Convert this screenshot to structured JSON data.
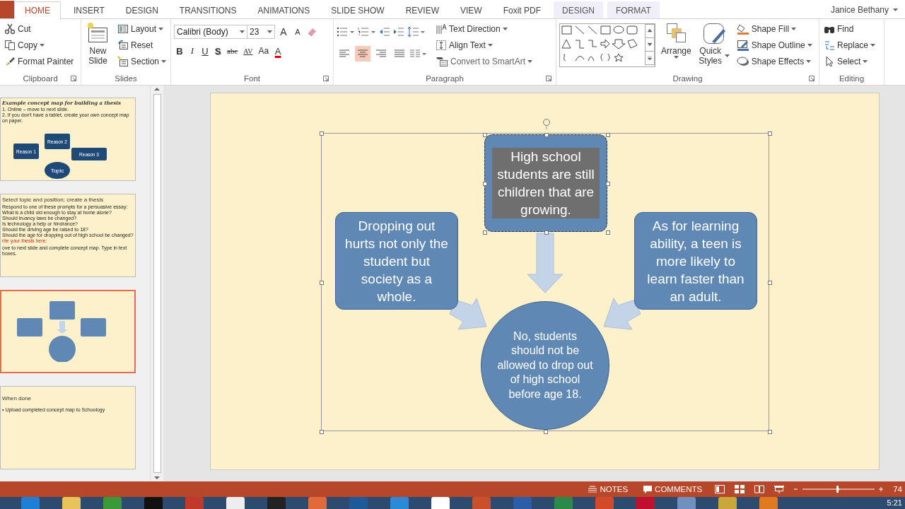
{
  "ribbon_tabs": [
    {
      "label": "HOME",
      "selected": true,
      "kind": "normal"
    },
    {
      "label": "INSERT",
      "selected": false,
      "kind": "normal"
    },
    {
      "label": "DESIGN",
      "selected": false,
      "kind": "normal"
    },
    {
      "label": "TRANSITIONS",
      "selected": false,
      "kind": "normal"
    },
    {
      "label": "ANIMATIONS",
      "selected": false,
      "kind": "normal"
    },
    {
      "label": "SLIDE SHOW",
      "selected": false,
      "kind": "normal"
    },
    {
      "label": "REVIEW",
      "selected": false,
      "kind": "normal"
    },
    {
      "label": "VIEW",
      "selected": false,
      "kind": "normal"
    },
    {
      "label": "Foxit PDF",
      "selected": false,
      "kind": "normal"
    },
    {
      "label": "DESIGN",
      "selected": false,
      "kind": "contextual"
    },
    {
      "label": "FORMAT",
      "selected": false,
      "kind": "contextual"
    }
  ],
  "user": "Janice Bethany",
  "clipboard": {
    "label": "Clipboard",
    "commands": [
      "Cut",
      "Copy",
      "Format Painter"
    ]
  },
  "slides_group": {
    "label": "Slides",
    "new_slide": "New Slide",
    "commands": [
      "Layout",
      "Reset",
      "Section"
    ]
  },
  "font": {
    "label": "Font",
    "family": "Calibri (Body)",
    "size": "23",
    "size_buttons": [
      "A",
      "A"
    ],
    "buttons": [
      {
        "label": "B",
        "kind": "bold"
      },
      {
        "label": "I",
        "kind": "italic"
      },
      {
        "label": "U",
        "kind": "underline"
      },
      {
        "label": "S",
        "kind": "shadow"
      },
      {
        "label": "abc",
        "kind": "strike"
      },
      {
        "label": "AV",
        "kind": "spacing"
      },
      {
        "label": "Aa",
        "kind": "case"
      },
      {
        "label": "A",
        "kind": "color"
      }
    ]
  },
  "paragraph": {
    "label": "Paragraph",
    "alignment": [
      {
        "selected": false
      },
      {
        "selected": true
      },
      {
        "selected": false
      },
      {
        "selected": false
      }
    ],
    "commands": [
      "Text Direction",
      "Align Text",
      "Convert to SmartArt"
    ]
  },
  "drawing": {
    "label": "Drawing",
    "arrange": "Arrange",
    "quick_styles": "Quick Styles",
    "commands": [
      "Shape Fill",
      "Shape Outline",
      "Shape Effects"
    ]
  },
  "editing": {
    "label": "Editing",
    "commands": [
      "Find",
      "Replace",
      "Select"
    ]
  },
  "thumbnails": [
    {
      "kind": "map",
      "selected": false,
      "title": "Example concept map for building a thesis",
      "lines": [
        "1. Online – move to next slide.",
        "2. If you don't have a tablet, create your own concept map on paper."
      ],
      "nodes": [
        "Reason 1",
        "Reason 2",
        "Reason 3",
        "Topic"
      ]
    },
    {
      "kind": "text",
      "selected": false,
      "title": "Select topic and position; create a thesis",
      "lines": [
        "Respond to one of these prompts for a persuasive essay:",
        "What is a child old enough to stay at home alone?",
        "Should truancy laws be changed?",
        "Is technology a help or hindrance?",
        "Should the driving age be raised to 18?",
        "Should the age for dropping out of high school be changed?"
      ],
      "note": "rite your thesis here:",
      "footer": "ove to next slide and complete concept map. Type in text boxes."
    },
    {
      "kind": "diagram",
      "selected": true
    },
    {
      "kind": "text",
      "selected": false,
      "title": "When done",
      "lines": [
        "• Upload completed concept map to Schoology"
      ]
    }
  ],
  "slide": {
    "nodes": [
      {
        "kind": "box",
        "text": "High school students are still children that are growing.",
        "selected": true
      },
      {
        "kind": "box",
        "text": "Dropping out hurts not only the student but society as a whole.",
        "selected": false
      },
      {
        "kind": "box",
        "text": "As for learning ability, a teen is more likely to learn faster than an adult.",
        "selected": false
      },
      {
        "kind": "circle",
        "text": "No, students should not be allowed to drop out of high school before age 18.",
        "selected": false
      }
    ]
  },
  "status_bar": {
    "notes": "NOTES",
    "comments": "COMMENTS",
    "zoom": "74"
  },
  "taskbar": {
    "time": "5:21"
  }
}
